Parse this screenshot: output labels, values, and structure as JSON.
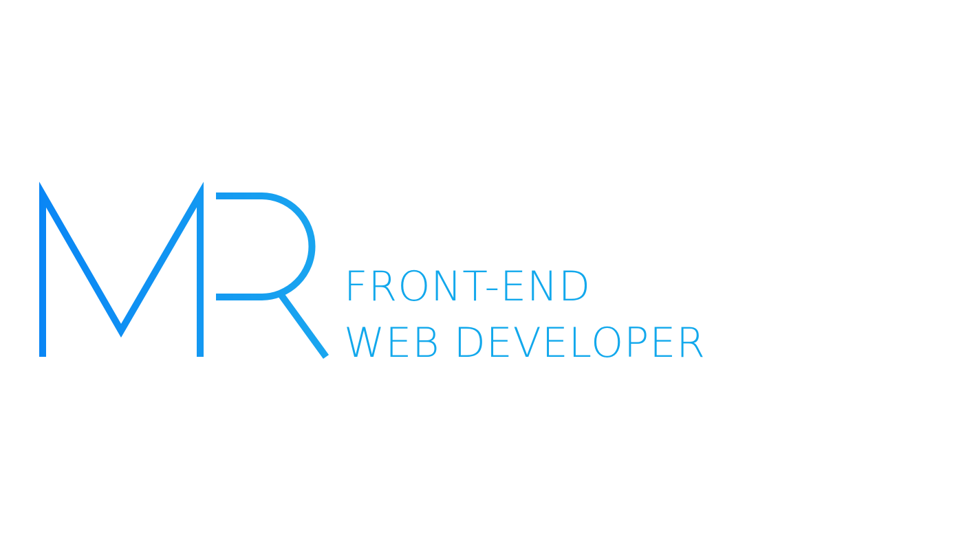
{
  "brand": {
    "monogram": "MR",
    "tagline_line_1": "FRONT-END",
    "tagline_line_2": "WEB DEVELOPER"
  },
  "colors": {
    "monogram_start": "#0a86f5",
    "monogram_end": "#1aa6ef",
    "tagline": "#12a8ec",
    "background": "#ffffff"
  }
}
